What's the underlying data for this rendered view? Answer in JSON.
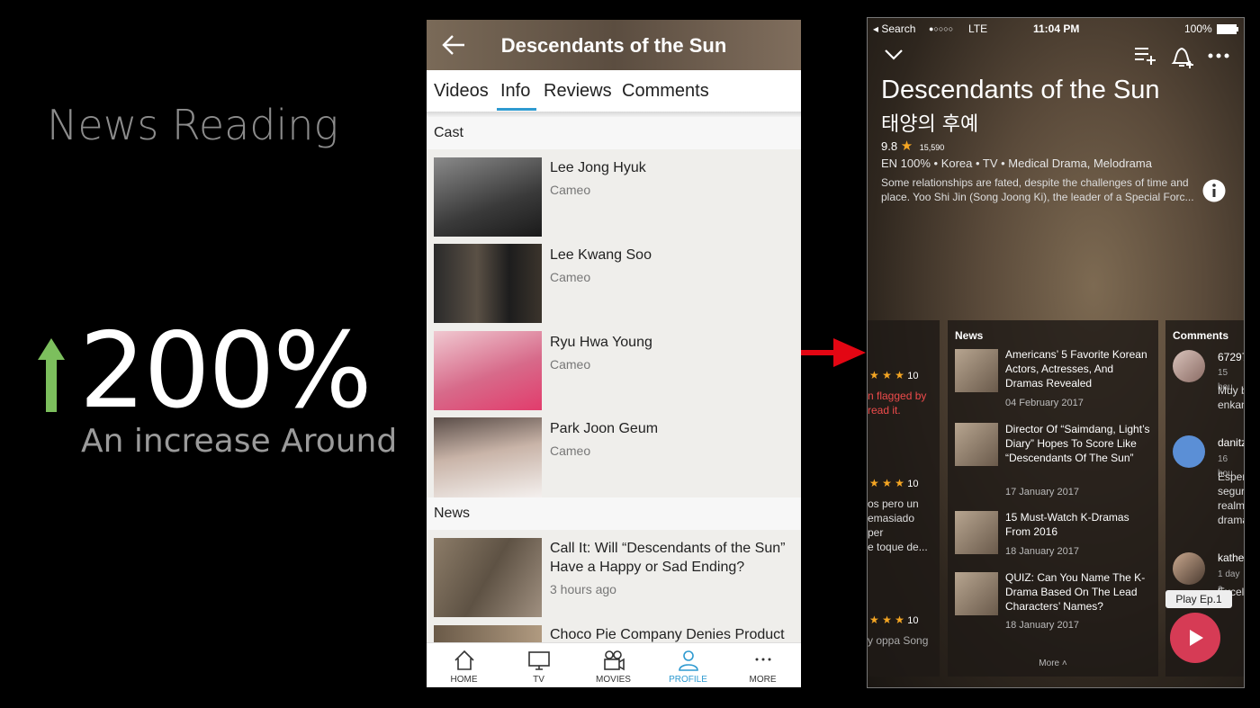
{
  "slide": {
    "heading": "News Reading",
    "stat": "200%",
    "stat_caption": "An increase Around"
  },
  "colors": {
    "accent_green": "#7cbf5d",
    "accent_red": "#e30613",
    "tab_blue": "#2e9ad0",
    "play_red": "#d63b55"
  },
  "old_app": {
    "title": "Descendants of the Sun",
    "tabs": [
      {
        "label": "Videos"
      },
      {
        "label": "Info"
      },
      {
        "label": "Reviews"
      },
      {
        "label": "Comments"
      }
    ],
    "active_tab": "Info",
    "cast_header": "Cast",
    "cast": [
      {
        "name": "Lee Jong Hyuk",
        "role": "Cameo"
      },
      {
        "name": "Lee Kwang Soo",
        "role": "Cameo"
      },
      {
        "name": "Ryu Hwa Young",
        "role": "Cameo"
      },
      {
        "name": "Park Joon Geum",
        "role": "Cameo"
      }
    ],
    "news_header": "News",
    "news": [
      {
        "title": "Call It: Will “Descendants of the Sun” Have a Happy or Sad Ending?",
        "time": "3 hours ago"
      },
      {
        "title": "Choco Pie Company Denies Product",
        "time": ""
      }
    ],
    "nav": [
      {
        "label": "HOME",
        "icon": "home-icon"
      },
      {
        "label": "TV",
        "icon": "tv-icon"
      },
      {
        "label": "MOVIES",
        "icon": "movies-icon"
      },
      {
        "label": "PROFILE",
        "icon": "profile-icon"
      },
      {
        "label": "MORE",
        "icon": "more-icon"
      }
    ]
  },
  "new_app": {
    "status": {
      "back": "Search",
      "signal": "●○○○○",
      "network": "LTE",
      "time": "11:04 PM",
      "battery": "100%"
    },
    "title": "Descendants of the Sun",
    "korean_title": "태양의 후예",
    "rating": "9.8",
    "rating_count": "15,590",
    "meta": "EN 100% • Korea • TV • Medical Drama, Melodrama",
    "description": "Some relationships are fated, despite the challenges of time and place. Yoo Shi Jin (Song Joong Ki), the leader of a Special Forc...",
    "left_card": {
      "items": [
        {
          "stars": "★ ★ ★",
          "score": "10",
          "text": "n flagged by\nread it."
        },
        {
          "stars": "★ ★ ★",
          "score": "10",
          "text": "os pero un\nemasiado\nper\ne toque de..."
        },
        {
          "stars": "★ ★ ★",
          "score": "10",
          "text": "y oppa Song"
        }
      ]
    },
    "news_card": {
      "header": "News",
      "items": [
        {
          "title": "Americans’ 5 Favorite Korean Actors, Actresses, And Dramas Revealed",
          "date": "04 February 2017"
        },
        {
          "title": "Director Of “Saimdang, Light’s Diary” Hopes To Score Like “Descendants Of The Sun”",
          "date": "17 January 2017"
        },
        {
          "title": "15 Must-Watch K-Dramas From 2016",
          "date": "18 January 2017"
        },
        {
          "title": "QUIZ: Can You Name The K-Drama Based On The Lead Characters’ Names?",
          "date": "18 January 2017"
        }
      ],
      "more": "More ˄"
    },
    "comments_card": {
      "header": "Comments",
      "items": [
        {
          "user": "67297",
          "time": "15 hou",
          "text": "Muy b\nenkan"
        },
        {
          "user": "danitz",
          "time": "16 hou",
          "text": "Esper\nsegur\nrealm\ndrama"
        },
        {
          "user": "kathe",
          "time": "1 day a",
          "text": "Excele"
        }
      ]
    },
    "play_label": "Play Ep.1"
  }
}
